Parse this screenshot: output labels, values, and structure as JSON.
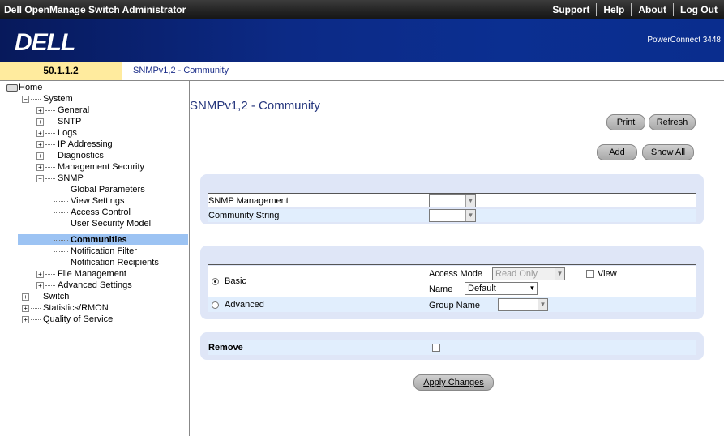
{
  "app": {
    "title": "Dell OpenManage Switch Administrator",
    "links": [
      "Support",
      "Help",
      "About",
      "Log Out"
    ]
  },
  "banner": {
    "logo": "DELL",
    "model": "PowerConnect 3448"
  },
  "address": {
    "ip": "50.1.1.2",
    "breadcrumb": "SNMPv1,2 - Community"
  },
  "tree": {
    "home": "Home",
    "system": "System",
    "general": "General",
    "sntp": "SNTP",
    "logs": "Logs",
    "ip_addressing": "IP Addressing",
    "diagnostics": "Diagnostics",
    "management_security": "Management Security",
    "snmp": "SNMP",
    "global_parameters": "Global Parameters",
    "view_settings": "View Settings",
    "access_control": "Access Control",
    "user_security_model": "User Security Model",
    "communities": "Communities",
    "notification_filter": "Notification Filter",
    "notification_recipients": "Notification Recipients",
    "file_management": "File Management",
    "advanced_settings": "Advanced Settings",
    "switch": "Switch",
    "statistics_rmon": "Statistics/RMON",
    "quality_of_service": "Quality of Service"
  },
  "page": {
    "title": "SNMPv1,2 - Community"
  },
  "buttons": {
    "print": "Print",
    "refresh": "Refresh",
    "add": "Add",
    "show_all": "Show All",
    "apply": "Apply Changes"
  },
  "form": {
    "snmp_management_label": "SNMP Management",
    "snmp_management_value": "",
    "community_string_label": "Community String",
    "community_string_value": "",
    "basic_label": "Basic",
    "advanced_label": "Advanced",
    "access_mode_label": "Access Mode",
    "access_mode_value": "Read Only",
    "view_label": "View",
    "name_label": "Name",
    "name_value": "Default",
    "group_name_label": "Group Name",
    "group_name_value": "",
    "remove_label": "Remove"
  },
  "state": {
    "basic_selected": true,
    "view_checked": false,
    "remove_checked": false
  }
}
